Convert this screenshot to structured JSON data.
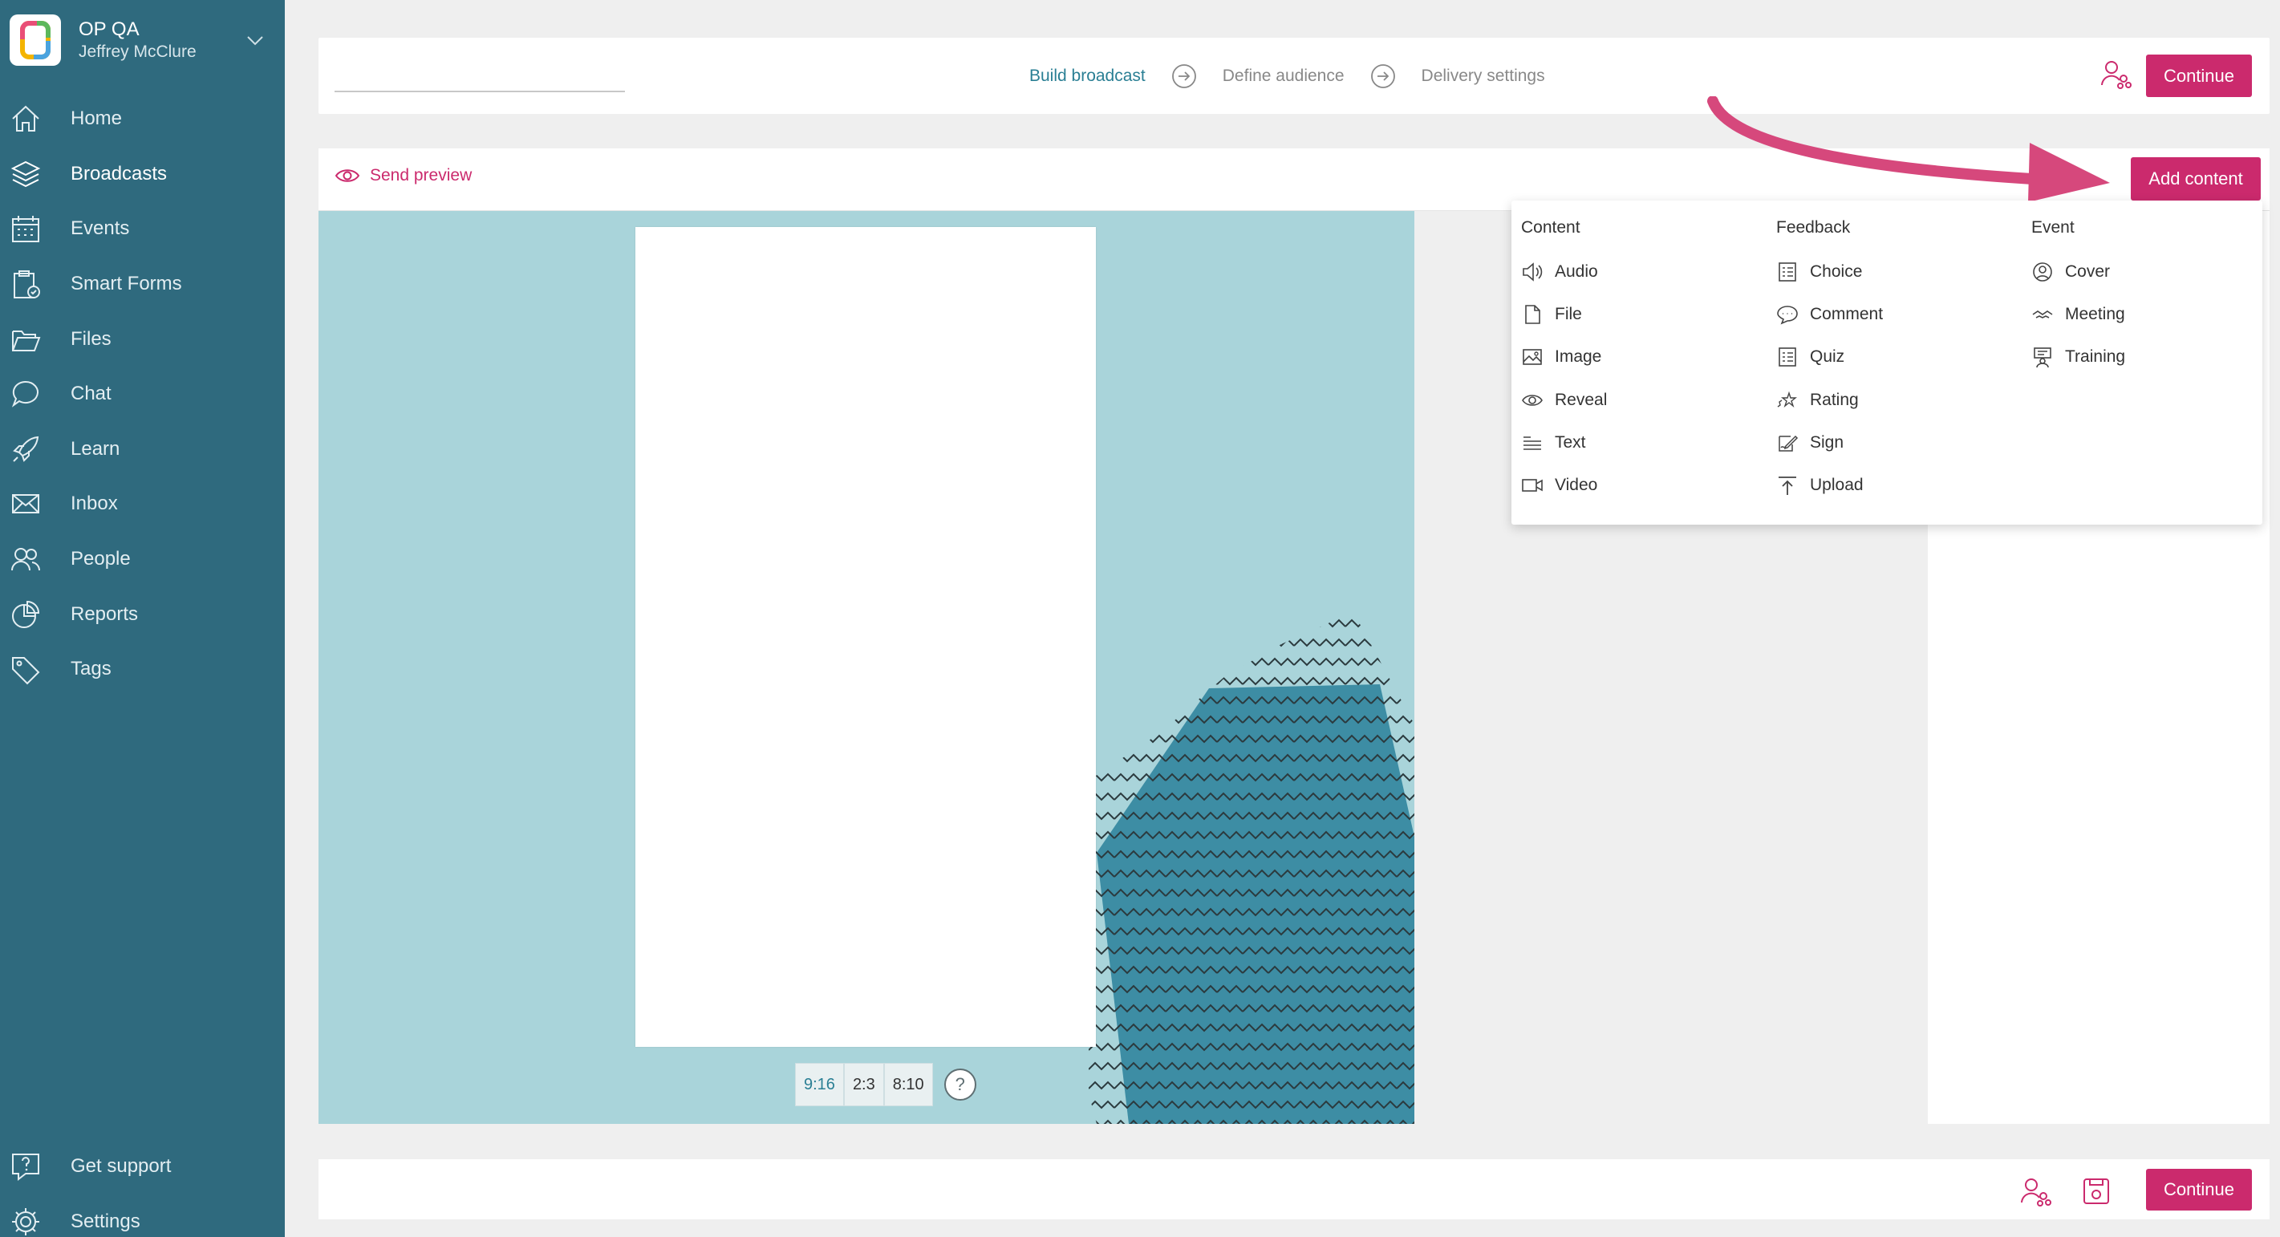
{
  "sidebar": {
    "org_name": "OP QA",
    "user_name": "Jeffrey McClure",
    "items": [
      {
        "label": "Home",
        "icon": "home-icon"
      },
      {
        "label": "Broadcasts",
        "icon": "layers-icon"
      },
      {
        "label": "Events",
        "icon": "calendar-icon"
      },
      {
        "label": "Smart Forms",
        "icon": "clipboard-icon"
      },
      {
        "label": "Files",
        "icon": "folder-icon"
      },
      {
        "label": "Chat",
        "icon": "chat-icon"
      },
      {
        "label": "Learn",
        "icon": "rocket-icon"
      },
      {
        "label": "Inbox",
        "icon": "mail-icon"
      },
      {
        "label": "People",
        "icon": "people-icon"
      },
      {
        "label": "Reports",
        "icon": "pie-chart-icon"
      },
      {
        "label": "Tags",
        "icon": "tag-icon"
      }
    ],
    "bottom_items": [
      {
        "label": "Get support",
        "icon": "help-icon"
      },
      {
        "label": "Settings",
        "icon": "gear-icon"
      }
    ]
  },
  "topbar": {
    "steps": [
      "Build broadcast",
      "Define audience",
      "Delivery settings"
    ],
    "continue_label": "Continue"
  },
  "editor": {
    "send_preview_label": "Send preview",
    "add_content_label": "Add content",
    "ratios": [
      "9:16",
      "2:3",
      "8:10"
    ],
    "help_label": "?"
  },
  "dropdown": {
    "columns": [
      {
        "heading": "Content",
        "items": [
          {
            "label": "Audio",
            "icon": "audio-icon"
          },
          {
            "label": "File",
            "icon": "file-icon"
          },
          {
            "label": "Image",
            "icon": "image-icon"
          },
          {
            "label": "Reveal",
            "icon": "eye-icon"
          },
          {
            "label": "Text",
            "icon": "text-icon"
          },
          {
            "label": "Video",
            "icon": "video-icon"
          }
        ]
      },
      {
        "heading": "Feedback",
        "items": [
          {
            "label": "Choice",
            "icon": "list-icon"
          },
          {
            "label": "Comment",
            "icon": "comment-icon"
          },
          {
            "label": "Quiz",
            "icon": "quiz-icon"
          },
          {
            "label": "Rating",
            "icon": "star-icon"
          },
          {
            "label": "Sign",
            "icon": "sign-icon"
          },
          {
            "label": "Upload",
            "icon": "upload-icon"
          }
        ]
      },
      {
        "heading": "Event",
        "items": [
          {
            "label": "Cover",
            "icon": "cover-icon"
          },
          {
            "label": "Meeting",
            "icon": "meeting-icon"
          },
          {
            "label": "Training",
            "icon": "training-icon"
          }
        ]
      }
    ]
  },
  "bottombar": {
    "continue_label": "Continue"
  },
  "colors": {
    "sidebar": "#2f6a7e",
    "accent": "#cb2a6d",
    "canvas": "#a9d4da",
    "teal_shape": "#3d8da4"
  }
}
